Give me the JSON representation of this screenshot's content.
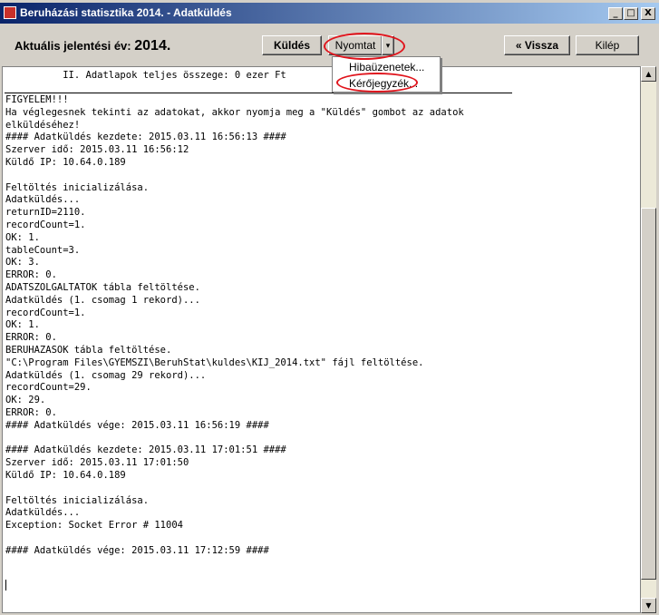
{
  "window": {
    "title": "Beruházási statisztika 2014. - Adatküldés",
    "controls": {
      "minimize": "_",
      "maximize": "□",
      "close": "X"
    }
  },
  "toolbar": {
    "year_label": "Aktuális jelentési év:",
    "year_value": "2014.",
    "send_label": "Küldés",
    "print_label": "Nyomtat",
    "print_dropdown_glyph": "▾",
    "back_label": "« Vissza",
    "exit_label": "Kilép"
  },
  "print_menu": {
    "items": [
      {
        "label": "Hibaüzenetek..."
      },
      {
        "label": "Kérőjegyzék..."
      }
    ]
  },
  "log": {
    "header": "          II. Adatlapok teljes összege: 0 ezer Ft",
    "lines": [
      "FIGYELEM!!!",
      "Ha véglegesnek tekinti az adatokat, akkor nyomja meg a \"Küldés\" gombot az adatok",
      "elküldéséhez!",
      "#### Adatküldés kezdete: 2015.03.11 16:56:13 ####",
      "Szerver idő: 2015.03.11 16:56:12",
      "Küldő IP: 10.64.0.189",
      "",
      "Feltöltés inicializálása.",
      "Adatküldés...",
      "returnID=2110.",
      "recordCount=1.",
      "OK: 1.",
      "tableCount=3.",
      "OK: 3.",
      "ERROR: 0.",
      "ADATSZOLGALTATOK tábla feltöltése.",
      "Adatküldés (1. csomag 1 rekord)...",
      "recordCount=1.",
      "OK: 1.",
      "ERROR: 0.",
      "BERUHAZASOK tábla feltöltése.",
      "\"C:\\Program Files\\GYEMSZI\\BeruhStat\\kuldes\\KIJ_2014.txt\" fájl feltöltése.",
      "Adatküldés (1. csomag 29 rekord)...",
      "recordCount=29.",
      "OK: 29.",
      "ERROR: 0.",
      "#### Adatküldés vége: 2015.03.11 16:56:19 ####",
      "",
      "#### Adatküldés kezdete: 2015.03.11 17:01:51 ####",
      "Szerver idő: 2015.03.11 17:01:50",
      "Küldő IP: 10.64.0.189",
      "",
      "Feltöltés inicializálása.",
      "Adatküldés...",
      "Exception: Socket Error # 11004",
      "",
      "#### Adatküldés vége: 2015.03.11 17:12:59 ####"
    ]
  },
  "scrollbar": {
    "up_glyph": "▲",
    "down_glyph": "▼"
  },
  "colors": {
    "titlebar_start": "#0a246a",
    "titlebar_end": "#a6caf0",
    "highlight_oval": "#e0141c"
  }
}
